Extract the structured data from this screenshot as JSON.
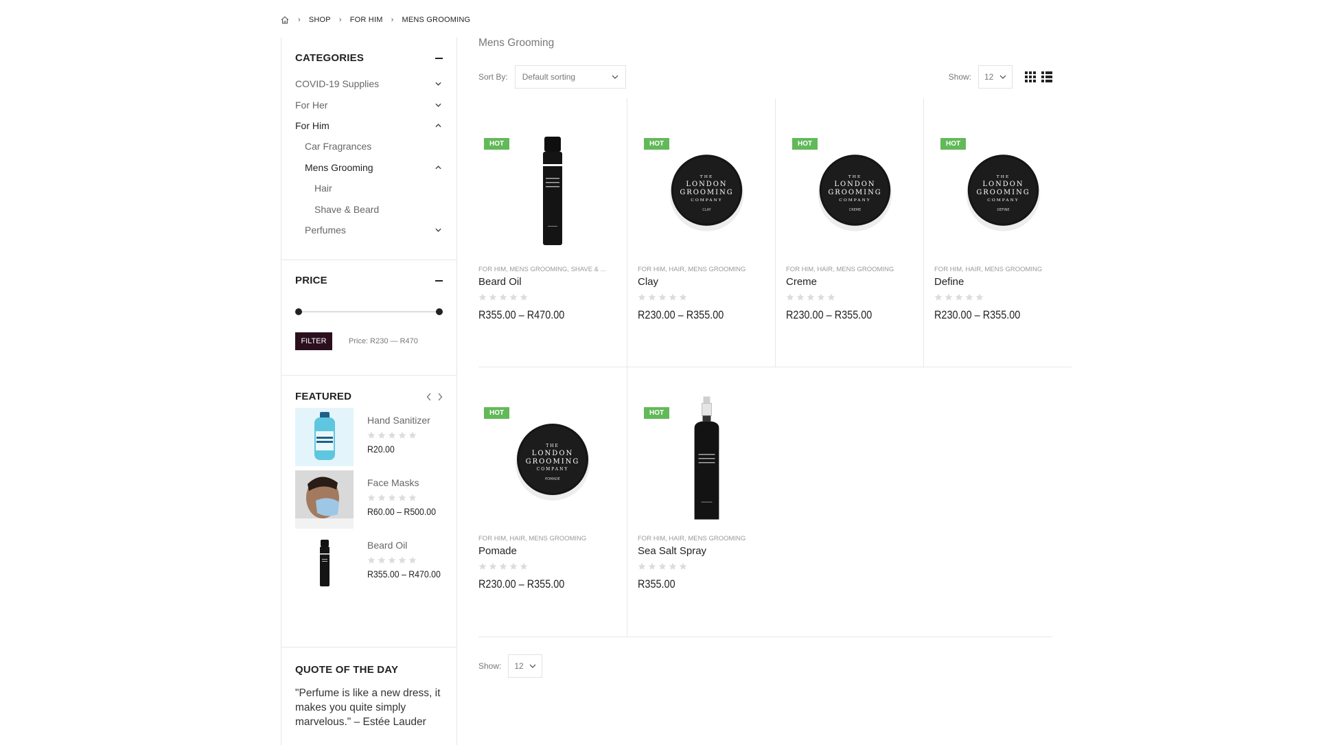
{
  "breadcrumb": {
    "home_icon": "home-icon",
    "items": [
      "SHOP",
      "FOR HIM",
      "MENS GROOMING"
    ]
  },
  "sidebar": {
    "categories": {
      "title": "CATEGORIES",
      "items": [
        {
          "label": "COVID-19 Supplies",
          "level": 0,
          "chevron": "down"
        },
        {
          "label": "For Her",
          "level": 0,
          "chevron": "down"
        },
        {
          "label": "For Him",
          "level": 0,
          "chevron": "up",
          "active": true
        },
        {
          "label": "Car Fragrances",
          "level": 1,
          "chevron": ""
        },
        {
          "label": "Mens Grooming",
          "level": 1,
          "chevron": "up",
          "active": true
        },
        {
          "label": "Hair",
          "level": 2,
          "chevron": ""
        },
        {
          "label": "Shave & Beard",
          "level": 2,
          "chevron": ""
        },
        {
          "label": "Perfumes",
          "level": 1,
          "chevron": "down"
        }
      ]
    },
    "price": {
      "title": "PRICE",
      "filter_label": "FILTER",
      "range_label": "Price: R230 — R470",
      "slider_min": 0.0,
      "slider_max": 1.0
    },
    "featured": {
      "title": "FEATURED",
      "items": [
        {
          "name": "Hand Sanitizer",
          "price": "R20.00",
          "rating": 0
        },
        {
          "name": "Face Masks",
          "price": "R60.00 – R500.00",
          "rating": 0
        },
        {
          "name": "Beard Oil",
          "price": "R355.00 – R470.00",
          "rating": 0
        }
      ]
    },
    "quote": {
      "title": "QUOTE OF THE DAY",
      "text": "\"Perfume is like a new dress, it makes you quite simply marvelous.\" – Estée Lauder"
    }
  },
  "main": {
    "title": "Mens Grooming",
    "sort_label": "Sort By:",
    "sort_value": "Default sorting",
    "show_label": "Show:",
    "show_value": "12",
    "products": [
      {
        "badge": "HOT",
        "cats": "FOR HIM, MENS GROOMING, SHAVE & ...",
        "name": "Beard Oil",
        "price": "R355.00 – R470.00",
        "kind": "bottle",
        "rating": 0
      },
      {
        "badge": "HOT",
        "cats": "FOR HIM, HAIR, MENS GROOMING",
        "name": "Clay",
        "price": "R230.00 – R355.00",
        "kind": "tin",
        "tin_label": "CLAY",
        "rating": 0
      },
      {
        "badge": "HOT",
        "cats": "FOR HIM, HAIR, MENS GROOMING",
        "name": "Creme",
        "price": "R230.00 – R355.00",
        "kind": "tin",
        "tin_label": "CREME",
        "rating": 0
      },
      {
        "badge": "HOT",
        "cats": "FOR HIM, HAIR, MENS GROOMING",
        "name": "Define",
        "price": "R230.00 – R355.00",
        "kind": "tin",
        "tin_label": "DEFINE",
        "rating": 0
      },
      {
        "badge": "HOT",
        "cats": "FOR HIM, HAIR, MENS GROOMING",
        "name": "Pomade",
        "price": "R230.00 – R355.00",
        "kind": "tin",
        "tin_label": "POMADE",
        "rating": 0
      },
      {
        "badge": "HOT",
        "cats": "FOR HIM, HAIR, MENS GROOMING",
        "name": "Sea Salt Spray",
        "price": "R355.00",
        "kind": "spray",
        "rating": 0
      }
    ],
    "bottom_show_label": "Show:",
    "bottom_show_value": "12"
  },
  "brand": {
    "tin_lines": [
      "THE",
      "LONDON",
      "GROOMING",
      "COMPANY"
    ]
  },
  "colors": {
    "accent_dark": "#2c0f1c",
    "badge_green": "#62b959",
    "text_dark": "#222222",
    "text_muted": "#777777",
    "border": "#e7e7e7"
  }
}
